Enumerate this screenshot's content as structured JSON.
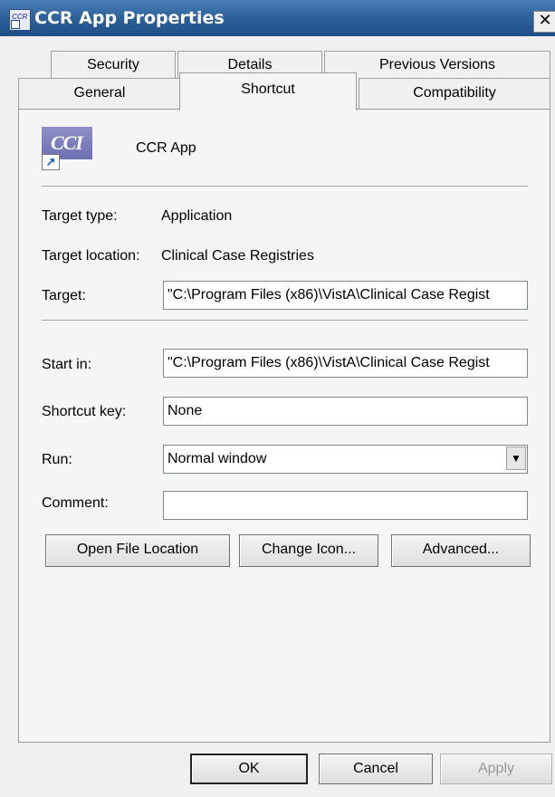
{
  "window": {
    "title": "CCR App Properties",
    "close_glyph": "✕"
  },
  "tabs_row1": [
    {
      "label": "Security"
    },
    {
      "label": "Details"
    },
    {
      "label": "Previous Versions"
    }
  ],
  "tabs_row2": [
    {
      "label": "General"
    },
    {
      "label": "Shortcut",
      "active": true
    },
    {
      "label": "Compatibility"
    }
  ],
  "shortcut": {
    "name": "CCR App",
    "icon": "ccr-app-icon",
    "target_type_label": "Target type:",
    "target_type_value": "Application",
    "target_location_label": "Target location:",
    "target_location_value": "Clinical Case Registries",
    "target_label": "Target:",
    "target_value": "\"C:\\Program Files (x86)\\VistA\\Clinical Case Regist",
    "start_in_label": "Start in:",
    "start_in_value": "\"C:\\Program Files (x86)\\VistA\\Clinical Case Regist",
    "shortcut_key_label": "Shortcut key:",
    "shortcut_key_value": "None",
    "run_label": "Run:",
    "run_value": "Normal window",
    "comment_label": "Comment:",
    "comment_value": ""
  },
  "buttons": {
    "open_file_location": "Open File Location",
    "change_icon": "Change Icon...",
    "advanced": "Advanced...",
    "ok": "OK",
    "cancel": "Cancel",
    "apply": "Apply"
  }
}
